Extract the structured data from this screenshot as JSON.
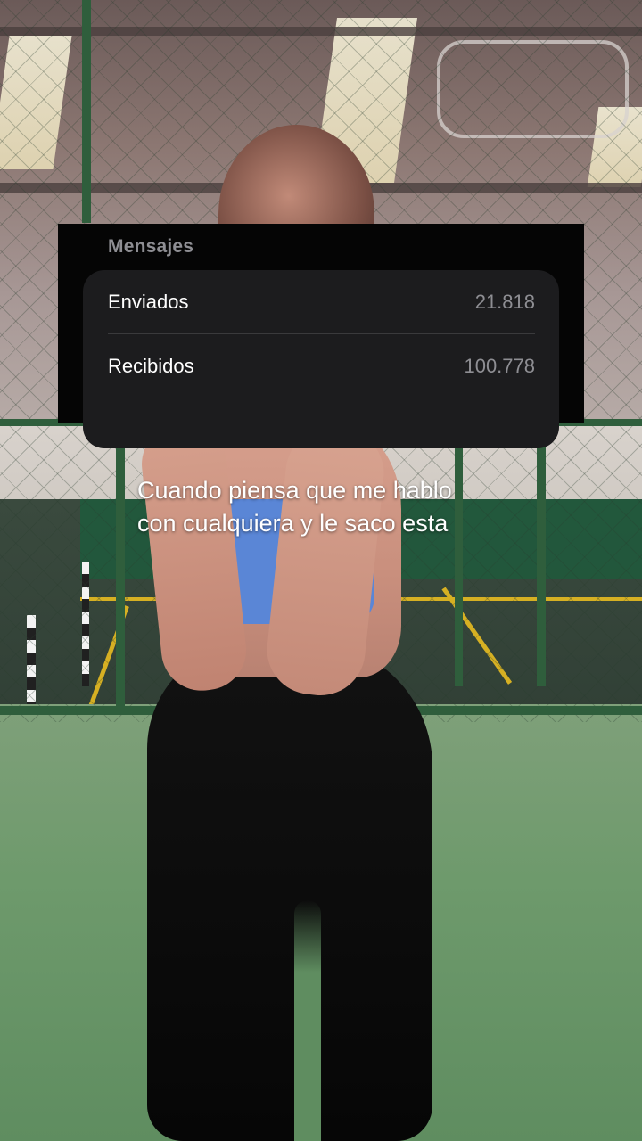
{
  "stats": {
    "section_title": "Mensajes",
    "rows": [
      {
        "label": "Enviados",
        "value": "21.818"
      },
      {
        "label": "Recibidos",
        "value": "100.778"
      }
    ]
  },
  "caption": {
    "text": "Cuando piensa que me hablo\ncon cualquiera y le saco esta"
  },
  "colors": {
    "panel_background": "#050505",
    "card_background": "#1c1c1e",
    "secondary_text": "#8e8e93",
    "primary_text": "#ffffff"
  }
}
